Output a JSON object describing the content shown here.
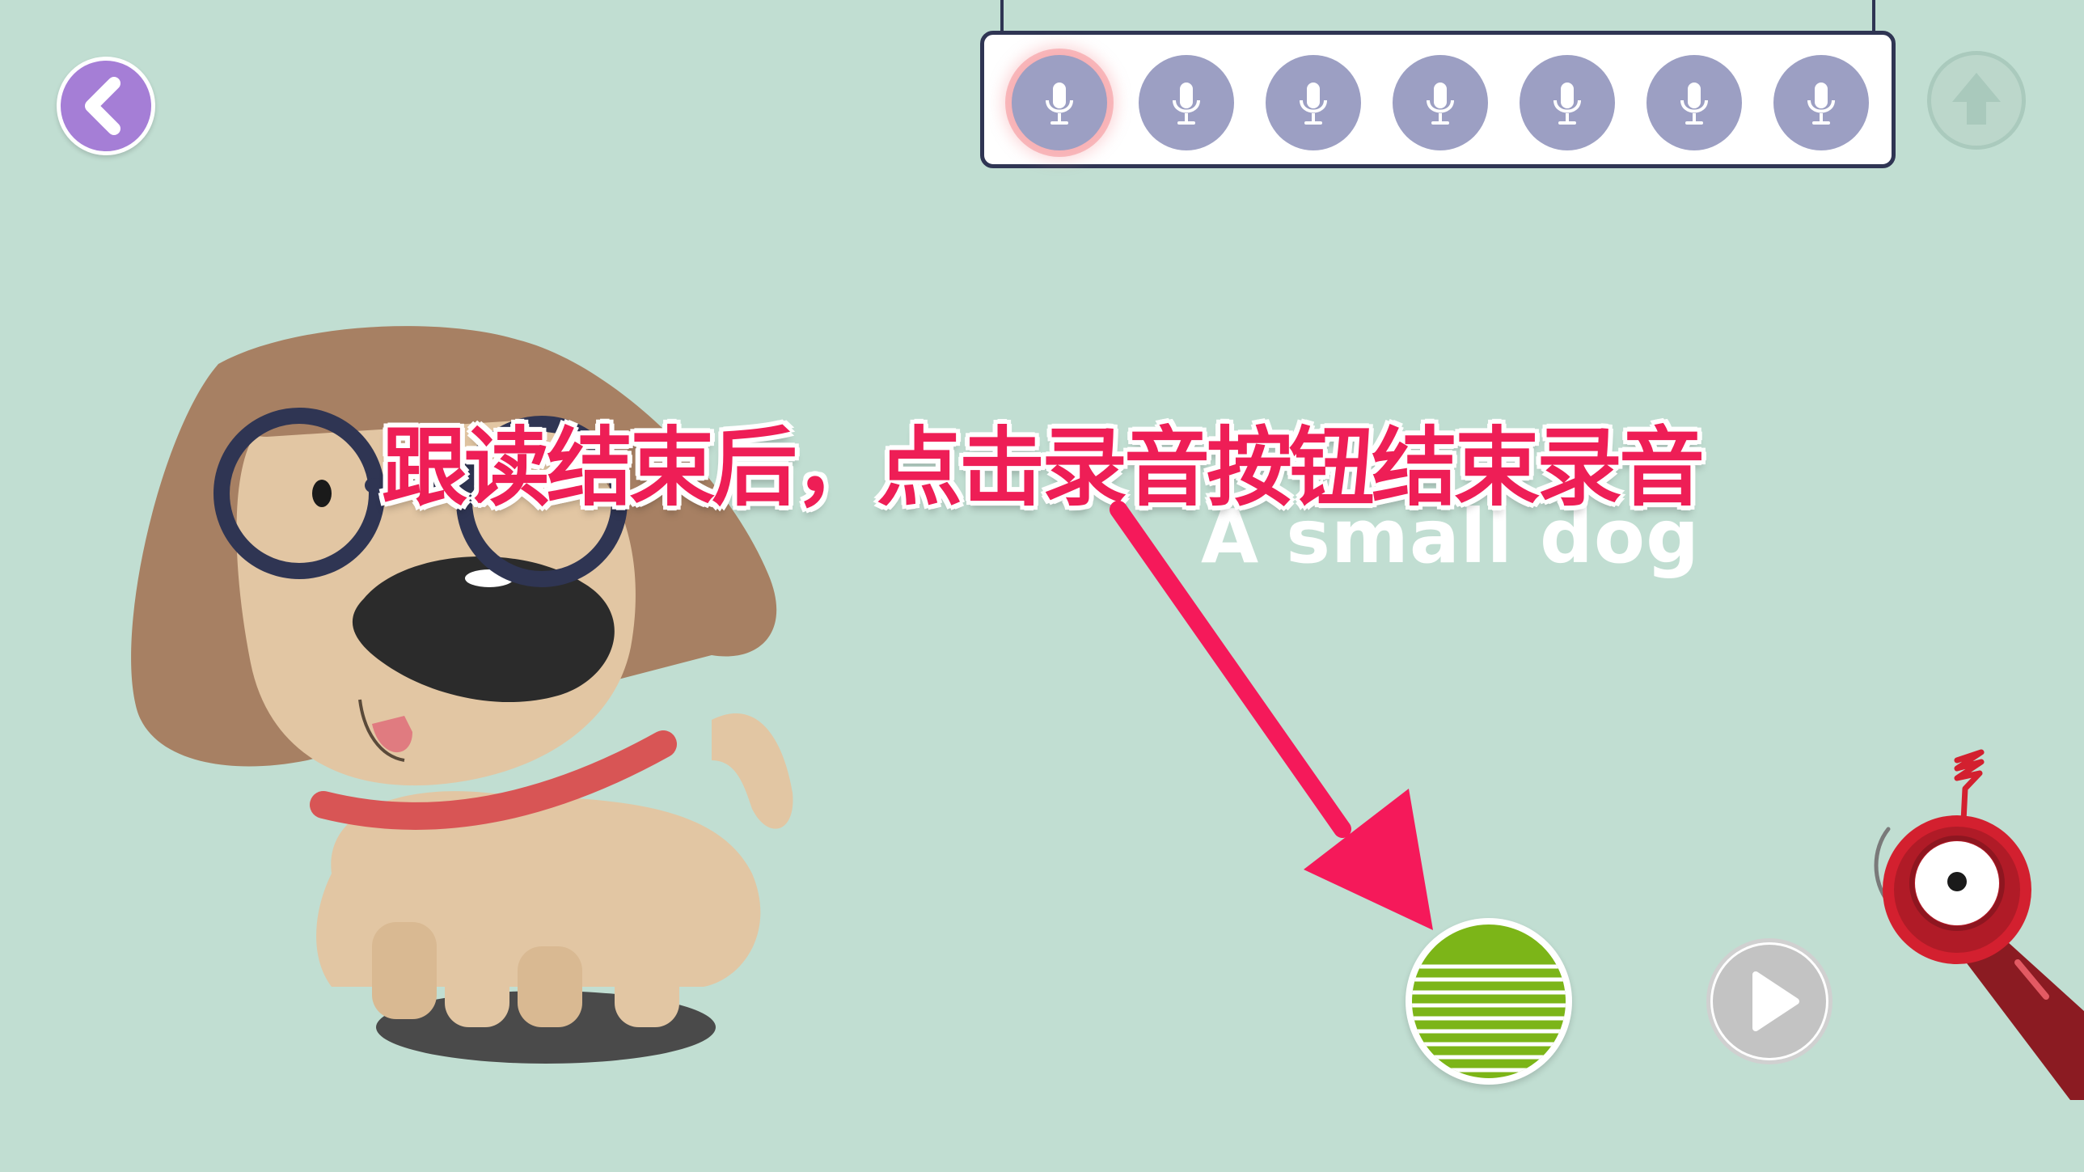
{
  "instruction": "跟读结束后，点击录音按钮结束录音",
  "word": "A small dog",
  "mic_slots": [
    {
      "icon": "microphone-icon",
      "active": true
    },
    {
      "icon": "microphone-icon",
      "active": false
    },
    {
      "icon": "microphone-icon",
      "active": false
    },
    {
      "icon": "microphone-icon",
      "active": false
    },
    {
      "icon": "microphone-icon",
      "active": false
    },
    {
      "icon": "microphone-icon",
      "active": false
    },
    {
      "icon": "microphone-icon",
      "active": false
    }
  ],
  "icons": {
    "back": "chevron-left-icon",
    "upload": "arrow-up-icon",
    "record": "recording-icon",
    "play": "play-icon"
  },
  "colors": {
    "background": "#c1ded2",
    "back_button": "#a57ed6",
    "mic_slot": "#9c9fc3",
    "mic_active_glow": "#f48f96",
    "instruction_text": "#ee1e56",
    "arrow": "#f5195a",
    "record_button": "#7cb518",
    "mascot": "#d3202f"
  }
}
